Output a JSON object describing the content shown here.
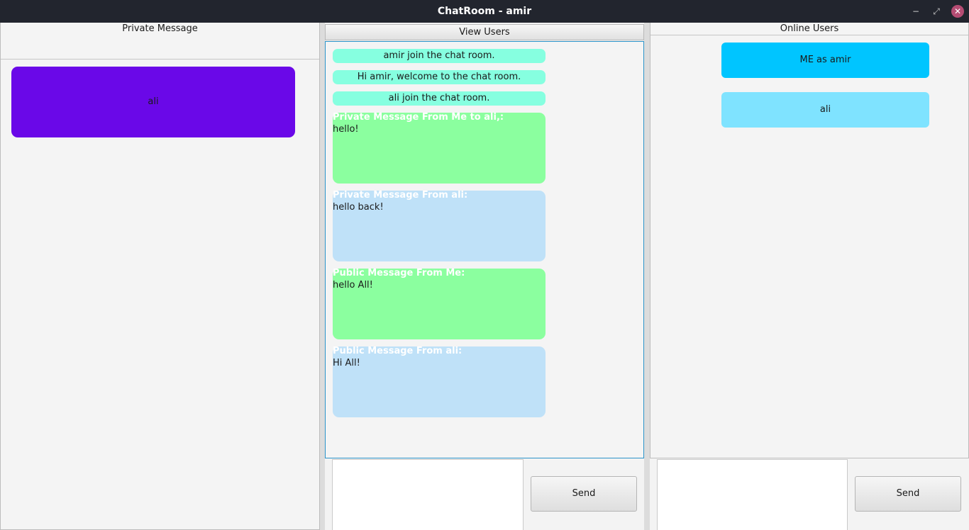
{
  "window": {
    "title": "ChatRoom - amir",
    "minimize_glyph": "−",
    "restore_glyph": "⤢",
    "close_glyph": "✕"
  },
  "left_panel": {
    "title": "Private Message",
    "recipient_button": "ali",
    "accent_color": "#6a08e8"
  },
  "center_panel": {
    "view_users_button": "View Users",
    "system_messages": [
      "amir join the chat room.",
      "Hi amir, welcome to the chat room.",
      "ali join the chat room."
    ],
    "messages": [
      {
        "header": "Private Message From Me to ali,:",
        "text": "hello!",
        "color": "#8bff9f"
      },
      {
        "header": "Private Message From ali:",
        "text": "hello back!",
        "color": "#bfe1f8"
      },
      {
        "header": "Public Message From Me:",
        "text": "hello All!",
        "color": "#8bff9f"
      },
      {
        "header": "Public Message From ali:",
        "text": "Hi All!",
        "color": "#bfe1f8"
      }
    ],
    "input_value": "",
    "send_label": "Send"
  },
  "right_panel": {
    "title": "Online Users",
    "users": [
      "ME as amir",
      "ali"
    ],
    "input_value": "",
    "send_label": "Send"
  }
}
